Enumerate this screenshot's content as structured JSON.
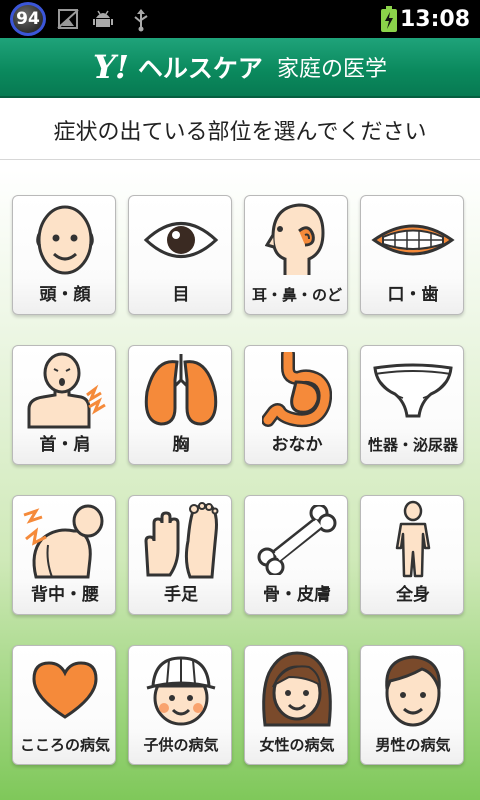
{
  "status_bar": {
    "battery_badge": "94",
    "time": "13:08",
    "icons": [
      "no-sim-icon",
      "android-debug-icon",
      "usb-icon",
      "battery-charging-icon"
    ]
  },
  "header": {
    "logo": "Y!",
    "brand": "ヘルスケア",
    "subtitle": "家庭の医学"
  },
  "prompt": "症状の出ている部位を選んでください",
  "colors": {
    "header_green": "#0b8a5e",
    "accent_orange": "#f58a3a",
    "skin_peach": "#fde2c8"
  },
  "tiles": [
    {
      "label": "頭・顔",
      "icon": "head-face-icon"
    },
    {
      "label": "目",
      "icon": "eye-icon"
    },
    {
      "label": "耳・鼻・のど",
      "icon": "ear-nose-throat-icon"
    },
    {
      "label": "口・歯",
      "icon": "mouth-teeth-icon"
    },
    {
      "label": "首・肩",
      "icon": "neck-shoulder-icon"
    },
    {
      "label": "胸",
      "icon": "lungs-icon"
    },
    {
      "label": "おなか",
      "icon": "stomach-icon"
    },
    {
      "label": "性器・泌尿器",
      "icon": "underwear-icon"
    },
    {
      "label": "背中・腰",
      "icon": "back-waist-icon"
    },
    {
      "label": "手足",
      "icon": "hand-foot-icon"
    },
    {
      "label": "骨・皮膚",
      "icon": "bone-icon"
    },
    {
      "label": "全身",
      "icon": "whole-body-icon"
    },
    {
      "label": "こころの病気",
      "icon": "heart-icon"
    },
    {
      "label": "子供の病気",
      "icon": "child-icon"
    },
    {
      "label": "女性の病気",
      "icon": "woman-icon"
    },
    {
      "label": "男性の病気",
      "icon": "man-icon"
    }
  ]
}
